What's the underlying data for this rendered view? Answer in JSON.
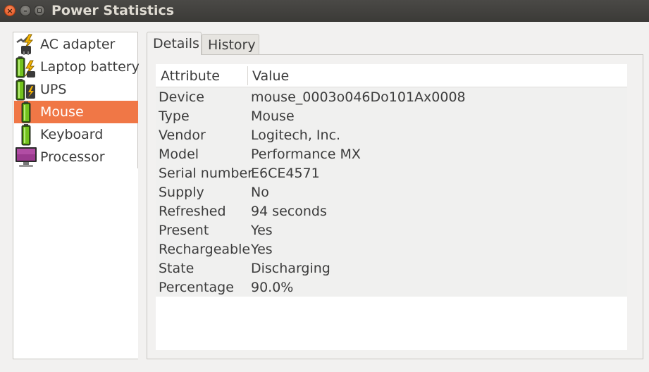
{
  "window": {
    "title": "Power Statistics"
  },
  "devices": [
    {
      "label": "AC adapter",
      "icon": "ac-adapter-icon"
    },
    {
      "label": "Laptop battery",
      "icon": "laptop-battery-icon"
    },
    {
      "label": "UPS",
      "icon": "ups-icon"
    },
    {
      "label": "Mouse",
      "icon": "mouse-battery-icon",
      "selected": true
    },
    {
      "label": "Keyboard",
      "icon": "keyboard-battery-icon"
    },
    {
      "label": "Processor",
      "icon": "processor-icon"
    }
  ],
  "tabs": [
    {
      "label": "Details",
      "active": true
    },
    {
      "label": "History",
      "active": false
    }
  ],
  "table": {
    "headers": {
      "attribute": "Attribute",
      "value": "Value"
    },
    "rows": [
      {
        "attribute": "Device",
        "value": "mouse_0003o046Do101Ax0008"
      },
      {
        "attribute": "Type",
        "value": "Mouse"
      },
      {
        "attribute": "Vendor",
        "value": "Logitech, Inc."
      },
      {
        "attribute": "Model",
        "value": "Performance MX"
      },
      {
        "attribute": "Serial number",
        "value": "E6CE4571"
      },
      {
        "attribute": "Supply",
        "value": "No"
      },
      {
        "attribute": "Refreshed",
        "value": "94 seconds"
      },
      {
        "attribute": "Present",
        "value": "Yes"
      },
      {
        "attribute": "Rechargeable",
        "value": "Yes"
      },
      {
        "attribute": "State",
        "value": "Discharging"
      },
      {
        "attribute": "Percentage",
        "value": "90.0%"
      }
    ]
  },
  "colors": {
    "selection": "#f07746",
    "titlebar": "#3c3b37",
    "battery_green": "#73c21e"
  }
}
